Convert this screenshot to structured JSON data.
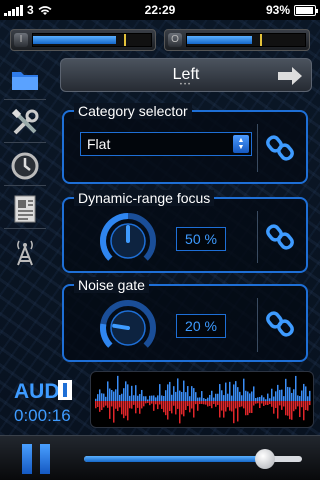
{
  "status_bar": {
    "carrier": "3",
    "time": "22:29",
    "battery": "93%",
    "battery_level": 0.93
  },
  "meters": [
    {
      "icon": "input-meter-icon",
      "level": 0.7,
      "peak": 0.77
    },
    {
      "icon": "output-meter-icon",
      "level": 0.55,
      "peak": 0.62
    }
  ],
  "sidebar": {
    "items": [
      {
        "icon": "folder-icon"
      },
      {
        "icon": "tools-icon"
      },
      {
        "icon": "clock-icon"
      },
      {
        "icon": "document-icon"
      },
      {
        "icon": "antenna-icon"
      }
    ]
  },
  "header": {
    "title": "Left",
    "dots": "•••",
    "arrow_icon": "right-arrow-icon"
  },
  "panels": {
    "category": {
      "label": "Category selector",
      "value": "Flat"
    },
    "drf": {
      "label": "Dynamic-range focus",
      "value": "50 %",
      "level": 0.5
    },
    "gate": {
      "label": "Noise gate",
      "value": "20 %",
      "level": 0.2
    }
  },
  "player": {
    "logo": "AUD",
    "timecode": "0:00:16",
    "progress": 0.83
  },
  "colors": {
    "accent": "#1e6fd6",
    "value_text": "#3e9bff",
    "wave_top": "#3a8df5",
    "wave_bottom": "#e0262a"
  }
}
